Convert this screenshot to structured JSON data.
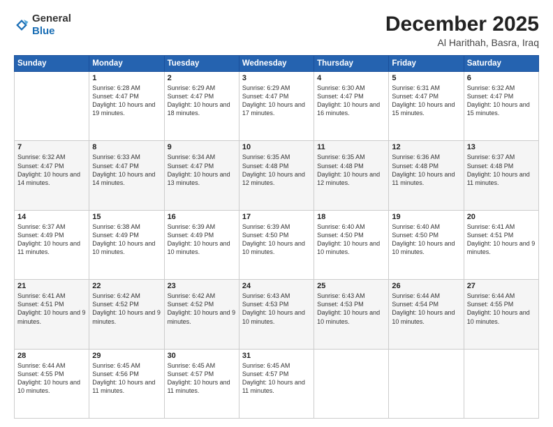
{
  "header": {
    "logo_general": "General",
    "logo_blue": "Blue",
    "month_year": "December 2025",
    "location": "Al Harithah, Basra, Iraq"
  },
  "days_of_week": [
    "Sunday",
    "Monday",
    "Tuesday",
    "Wednesday",
    "Thursday",
    "Friday",
    "Saturday"
  ],
  "weeks": [
    [
      {
        "day": "",
        "sunrise": "",
        "sunset": "",
        "daylight": ""
      },
      {
        "day": "1",
        "sunrise": "Sunrise: 6:28 AM",
        "sunset": "Sunset: 4:47 PM",
        "daylight": "Daylight: 10 hours and 19 minutes."
      },
      {
        "day": "2",
        "sunrise": "Sunrise: 6:29 AM",
        "sunset": "Sunset: 4:47 PM",
        "daylight": "Daylight: 10 hours and 18 minutes."
      },
      {
        "day": "3",
        "sunrise": "Sunrise: 6:29 AM",
        "sunset": "Sunset: 4:47 PM",
        "daylight": "Daylight: 10 hours and 17 minutes."
      },
      {
        "day": "4",
        "sunrise": "Sunrise: 6:30 AM",
        "sunset": "Sunset: 4:47 PM",
        "daylight": "Daylight: 10 hours and 16 minutes."
      },
      {
        "day": "5",
        "sunrise": "Sunrise: 6:31 AM",
        "sunset": "Sunset: 4:47 PM",
        "daylight": "Daylight: 10 hours and 15 minutes."
      },
      {
        "day": "6",
        "sunrise": "Sunrise: 6:32 AM",
        "sunset": "Sunset: 4:47 PM",
        "daylight": "Daylight: 10 hours and 15 minutes."
      }
    ],
    [
      {
        "day": "7",
        "sunrise": "Sunrise: 6:32 AM",
        "sunset": "Sunset: 4:47 PM",
        "daylight": "Daylight: 10 hours and 14 minutes."
      },
      {
        "day": "8",
        "sunrise": "Sunrise: 6:33 AM",
        "sunset": "Sunset: 4:47 PM",
        "daylight": "Daylight: 10 hours and 14 minutes."
      },
      {
        "day": "9",
        "sunrise": "Sunrise: 6:34 AM",
        "sunset": "Sunset: 4:47 PM",
        "daylight": "Daylight: 10 hours and 13 minutes."
      },
      {
        "day": "10",
        "sunrise": "Sunrise: 6:35 AM",
        "sunset": "Sunset: 4:48 PM",
        "daylight": "Daylight: 10 hours and 12 minutes."
      },
      {
        "day": "11",
        "sunrise": "Sunrise: 6:35 AM",
        "sunset": "Sunset: 4:48 PM",
        "daylight": "Daylight: 10 hours and 12 minutes."
      },
      {
        "day": "12",
        "sunrise": "Sunrise: 6:36 AM",
        "sunset": "Sunset: 4:48 PM",
        "daylight": "Daylight: 10 hours and 11 minutes."
      },
      {
        "day": "13",
        "sunrise": "Sunrise: 6:37 AM",
        "sunset": "Sunset: 4:48 PM",
        "daylight": "Daylight: 10 hours and 11 minutes."
      }
    ],
    [
      {
        "day": "14",
        "sunrise": "Sunrise: 6:37 AM",
        "sunset": "Sunset: 4:49 PM",
        "daylight": "Daylight: 10 hours and 11 minutes."
      },
      {
        "day": "15",
        "sunrise": "Sunrise: 6:38 AM",
        "sunset": "Sunset: 4:49 PM",
        "daylight": "Daylight: 10 hours and 10 minutes."
      },
      {
        "day": "16",
        "sunrise": "Sunrise: 6:39 AM",
        "sunset": "Sunset: 4:49 PM",
        "daylight": "Daylight: 10 hours and 10 minutes."
      },
      {
        "day": "17",
        "sunrise": "Sunrise: 6:39 AM",
        "sunset": "Sunset: 4:50 PM",
        "daylight": "Daylight: 10 hours and 10 minutes."
      },
      {
        "day": "18",
        "sunrise": "Sunrise: 6:40 AM",
        "sunset": "Sunset: 4:50 PM",
        "daylight": "Daylight: 10 hours and 10 minutes."
      },
      {
        "day": "19",
        "sunrise": "Sunrise: 6:40 AM",
        "sunset": "Sunset: 4:50 PM",
        "daylight": "Daylight: 10 hours and 10 minutes."
      },
      {
        "day": "20",
        "sunrise": "Sunrise: 6:41 AM",
        "sunset": "Sunset: 4:51 PM",
        "daylight": "Daylight: 10 hours and 9 minutes."
      }
    ],
    [
      {
        "day": "21",
        "sunrise": "Sunrise: 6:41 AM",
        "sunset": "Sunset: 4:51 PM",
        "daylight": "Daylight: 10 hours and 9 minutes."
      },
      {
        "day": "22",
        "sunrise": "Sunrise: 6:42 AM",
        "sunset": "Sunset: 4:52 PM",
        "daylight": "Daylight: 10 hours and 9 minutes."
      },
      {
        "day": "23",
        "sunrise": "Sunrise: 6:42 AM",
        "sunset": "Sunset: 4:52 PM",
        "daylight": "Daylight: 10 hours and 9 minutes."
      },
      {
        "day": "24",
        "sunrise": "Sunrise: 6:43 AM",
        "sunset": "Sunset: 4:53 PM",
        "daylight": "Daylight: 10 hours and 10 minutes."
      },
      {
        "day": "25",
        "sunrise": "Sunrise: 6:43 AM",
        "sunset": "Sunset: 4:53 PM",
        "daylight": "Daylight: 10 hours and 10 minutes."
      },
      {
        "day": "26",
        "sunrise": "Sunrise: 6:44 AM",
        "sunset": "Sunset: 4:54 PM",
        "daylight": "Daylight: 10 hours and 10 minutes."
      },
      {
        "day": "27",
        "sunrise": "Sunrise: 6:44 AM",
        "sunset": "Sunset: 4:55 PM",
        "daylight": "Daylight: 10 hours and 10 minutes."
      }
    ],
    [
      {
        "day": "28",
        "sunrise": "Sunrise: 6:44 AM",
        "sunset": "Sunset: 4:55 PM",
        "daylight": "Daylight: 10 hours and 10 minutes."
      },
      {
        "day": "29",
        "sunrise": "Sunrise: 6:45 AM",
        "sunset": "Sunset: 4:56 PM",
        "daylight": "Daylight: 10 hours and 11 minutes."
      },
      {
        "day": "30",
        "sunrise": "Sunrise: 6:45 AM",
        "sunset": "Sunset: 4:57 PM",
        "daylight": "Daylight: 10 hours and 11 minutes."
      },
      {
        "day": "31",
        "sunrise": "Sunrise: 6:45 AM",
        "sunset": "Sunset: 4:57 PM",
        "daylight": "Daylight: 10 hours and 11 minutes."
      },
      {
        "day": "",
        "sunrise": "",
        "sunset": "",
        "daylight": ""
      },
      {
        "day": "",
        "sunrise": "",
        "sunset": "",
        "daylight": ""
      },
      {
        "day": "",
        "sunrise": "",
        "sunset": "",
        "daylight": ""
      }
    ]
  ]
}
